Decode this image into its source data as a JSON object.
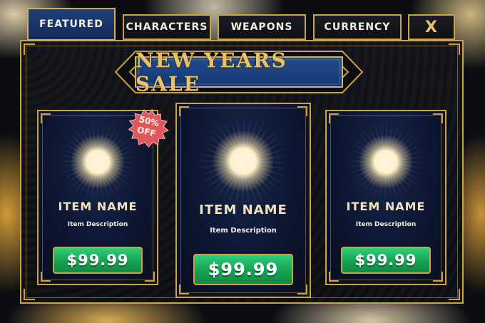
{
  "tabs": [
    {
      "id": "featured",
      "label": "FEATURED",
      "active": true
    },
    {
      "id": "characters",
      "label": "CHARACTERS",
      "active": false
    },
    {
      "id": "weapons",
      "label": "WEAPONS",
      "active": false
    },
    {
      "id": "currency",
      "label": "CURRENCY",
      "active": false
    }
  ],
  "close_label": "X",
  "banner": {
    "title": "NEW YEARS SALE"
  },
  "badge": {
    "line1": "50%",
    "line2": "OFF"
  },
  "items": [
    {
      "name": "ITEM NAME",
      "description": "Item Description",
      "price": "$99.99",
      "icon": "glowing-orb-icon"
    },
    {
      "name": "ITEM NAME",
      "description": "Item Description",
      "price": "$99.99",
      "icon": "glowing-orb-icon"
    },
    {
      "name": "ITEM NAME",
      "description": "Item Description",
      "price": "$99.99",
      "icon": "glowing-orb-icon"
    }
  ],
  "colors": {
    "gold": "#c9a24a",
    "active_tab": "#1e3f7a",
    "card_bg": "#0c1530",
    "price_button": "#16a152",
    "badge": "#e0575c"
  }
}
